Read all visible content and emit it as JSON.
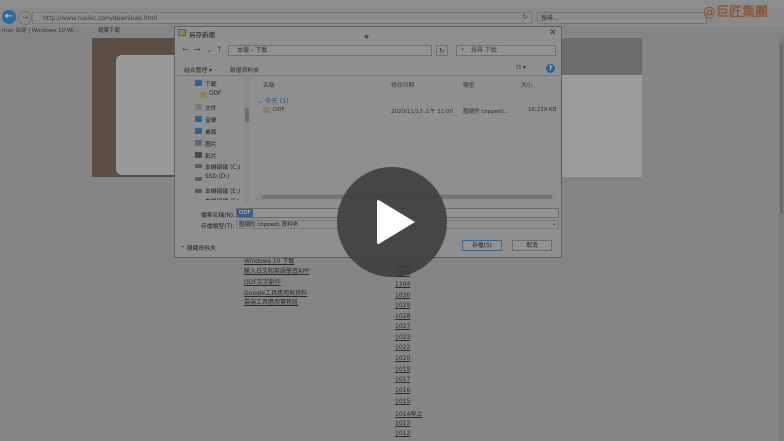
{
  "browser": {
    "url": "http://www.ruelec.com/download.html",
    "search_placeholder": "搜尋...",
    "brand": "@巨匠集團",
    "tabs": [
      {
        "label": "msn 台灣 | Windows 10 Wi..."
      },
      {
        "label": "檔案下載"
      }
    ]
  },
  "page": {
    "links": [
      "Windows 10 下載",
      "輸入日文和英語學習APP",
      "ODF文字創作",
      "Google工具應用與資料",
      "雲端工具應用實務班"
    ],
    "numbers": [
      "1109",
      "1105",
      "1104",
      "1030",
      "1029",
      "1028",
      "1027",
      "1023",
      "1022",
      "1020",
      "1019",
      "1017",
      "1016",
      "1015",
      "1014早上",
      "1013",
      "1012"
    ]
  },
  "dialog": {
    "title": "另存新檔",
    "close": "✕",
    "breadcrumb": [
      "本機",
      "下載"
    ],
    "search_placeholder": "搜尋 下載",
    "toolbar": {
      "organize": "組合管理 ▾",
      "new_folder": "新增資料夾",
      "view": "☷ ▾",
      "help": "?"
    },
    "nav_items": [
      {
        "label": "下載",
        "icon": "download-icon",
        "color": "#2f5f93"
      },
      {
        "label": "ODF",
        "icon": "folder-icon",
        "color": "#8c7f5a"
      },
      {
        "label": "文件",
        "icon": "document-icon",
        "color": "#7a7a7a"
      },
      {
        "label": "音樂",
        "icon": "music-icon",
        "color": "#2f5f93"
      },
      {
        "label": "桌面",
        "icon": "desktop-icon",
        "color": "#2f5f93"
      },
      {
        "label": "圖片",
        "icon": "picture-icon",
        "color": "#5a6a7a"
      },
      {
        "label": "影片",
        "icon": "video-icon",
        "color": "#4a4a4a"
      },
      {
        "label": "本機磁碟 (C:)",
        "icon": "drive-icon",
        "color": "#5a5a5a"
      },
      {
        "label": "SSD (D:)",
        "icon": "drive-icon",
        "color": "#5a5a5a"
      },
      {
        "label": "本機磁碟 (E:)",
        "icon": "drive-icon",
        "color": "#5a5a5a"
      },
      {
        "label": "本機磁碟 (F:)",
        "icon": "drive-icon",
        "color": "#5a5a5a"
      }
    ],
    "columns": {
      "name": "名稱",
      "modified": "修改日期",
      "type": "類型",
      "size": "大小"
    },
    "group": "⌄ 今天 (1)",
    "files": [
      {
        "name": "ODF",
        "modified": "2020/11/13 上午 11:00",
        "type": "壓縮的 (zipped)...",
        "size": "18,229 KB"
      }
    ],
    "filename_label": "檔案名稱(N):",
    "filename_value": "ODF",
    "type_label": "存檔類型(T):",
    "type_value": "壓縮的 (zipped) 資料夾",
    "hide_folders": "⌃ 隱藏資料夾",
    "save_label": "存檔(S)",
    "cancel_label": "取消"
  },
  "overlay": {
    "play_icon": "play-icon"
  }
}
